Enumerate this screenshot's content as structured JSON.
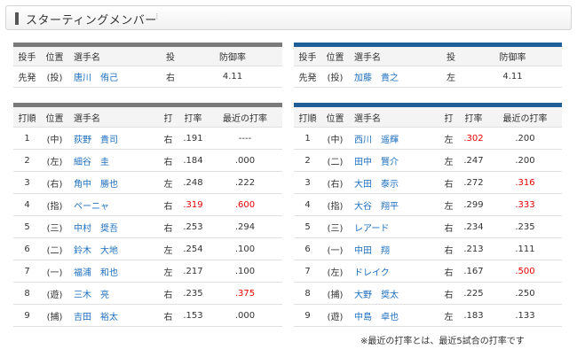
{
  "header": {
    "title": "スターティングメンバー",
    "dots": "⁝"
  },
  "pitchers": {
    "columns": [
      "投手",
      "位置",
      "選手名",
      "投",
      "防御率"
    ],
    "left": {
      "role": "先発",
      "pos": "(投)",
      "name": "唐川　侑己",
      "throws": "右",
      "era": "4.11"
    },
    "right": {
      "role": "先発",
      "pos": "(投)",
      "name": "加藤　貴之",
      "throws": "左",
      "era": "4.11"
    }
  },
  "lineups": {
    "columns": [
      "打順",
      "位置",
      "選手名",
      "打",
      "打率",
      "最近の打率"
    ],
    "left": [
      {
        "order": "1",
        "pos": "(中)",
        "name": "荻野　貴司",
        "bats": "右",
        "avg": ".191",
        "recent": "----",
        "avg_red": false,
        "recent_red": false
      },
      {
        "order": "2",
        "pos": "(左)",
        "name": "細谷　圭",
        "bats": "右",
        "avg": ".184",
        "recent": ".000",
        "avg_red": false,
        "recent_red": false
      },
      {
        "order": "3",
        "pos": "(右)",
        "name": "角中　勝也",
        "bats": "左",
        "avg": ".248",
        "recent": ".222",
        "avg_red": false,
        "recent_red": false
      },
      {
        "order": "4",
        "pos": "(指)",
        "name": "ペーニャ",
        "bats": "右",
        "avg": ".319",
        "recent": ".600",
        "avg_red": true,
        "recent_red": true
      },
      {
        "order": "5",
        "pos": "(三)",
        "name": "中村　奨吾",
        "bats": "右",
        "avg": ".253",
        "recent": ".294",
        "avg_red": false,
        "recent_red": false
      },
      {
        "order": "6",
        "pos": "(二)",
        "name": "鈴木　大地",
        "bats": "左",
        "avg": ".254",
        "recent": ".100",
        "avg_red": false,
        "recent_red": false
      },
      {
        "order": "7",
        "pos": "(一)",
        "name": "福浦　和也",
        "bats": "左",
        "avg": ".217",
        "recent": ".100",
        "avg_red": false,
        "recent_red": false
      },
      {
        "order": "8",
        "pos": "(遊)",
        "name": "三木　亮",
        "bats": "右",
        "avg": ".235",
        "recent": ".375",
        "avg_red": false,
        "recent_red": true
      },
      {
        "order": "9",
        "pos": "(捕)",
        "name": "吉田　裕太",
        "bats": "右",
        "avg": ".153",
        "recent": ".000",
        "avg_red": false,
        "recent_red": false
      }
    ],
    "right": [
      {
        "order": "1",
        "pos": "(中)",
        "name": "西川　遥輝",
        "bats": "左",
        "avg": ".302",
        "recent": ".200",
        "avg_red": true,
        "recent_red": false
      },
      {
        "order": "2",
        "pos": "(二)",
        "name": "田中　賢介",
        "bats": "左",
        "avg": ".247",
        "recent": ".200",
        "avg_red": false,
        "recent_red": false
      },
      {
        "order": "3",
        "pos": "(右)",
        "name": "大田　泰示",
        "bats": "右",
        "avg": ".272",
        "recent": ".316",
        "avg_red": false,
        "recent_red": true
      },
      {
        "order": "4",
        "pos": "(指)",
        "name": "大谷　翔平",
        "bats": "左",
        "avg": ".299",
        "recent": ".333",
        "avg_red": false,
        "recent_red": true
      },
      {
        "order": "5",
        "pos": "(三)",
        "name": "レアード",
        "bats": "右",
        "avg": ".234",
        "recent": ".235",
        "avg_red": false,
        "recent_red": false
      },
      {
        "order": "6",
        "pos": "(一)",
        "name": "中田　翔",
        "bats": "右",
        "avg": ".213",
        "recent": ".111",
        "avg_red": false,
        "recent_red": false
      },
      {
        "order": "7",
        "pos": "(左)",
        "name": "ドレイク",
        "bats": "右",
        "avg": ".167",
        "recent": ".500",
        "avg_red": false,
        "recent_red": true
      },
      {
        "order": "8",
        "pos": "(捕)",
        "name": "大野　奨太",
        "bats": "右",
        "avg": ".225",
        "recent": ".250",
        "avg_red": false,
        "recent_red": false
      },
      {
        "order": "9",
        "pos": "(遊)",
        "name": "中島　卓也",
        "bats": "左",
        "avg": ".183",
        "recent": ".133",
        "avg_red": false,
        "recent_red": false
      }
    ]
  },
  "footnote": "※最近の打率とは、最近5試合の打率です",
  "colors": {
    "left_accent": "#7a7a7a",
    "right_accent": "#1e5f98",
    "name_link": "#1d6fbf",
    "highlight": "#e60000"
  }
}
